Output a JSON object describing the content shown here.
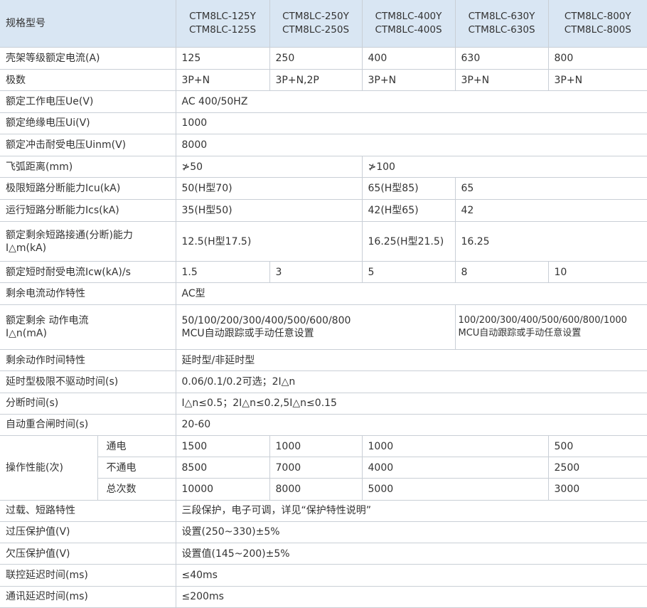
{
  "header": {
    "label": "规格型号",
    "models": [
      {
        "l1": "CTM8LC-125Y",
        "l2": "CTM8LC-125S"
      },
      {
        "l1": "CTM8LC-250Y",
        "l2": "CTM8LC-250S"
      },
      {
        "l1": "CTM8LC-400Y",
        "l2": "CTM8LC-400S"
      },
      {
        "l1": "CTM8LC-630Y",
        "l2": "CTM8LC-630S"
      },
      {
        "l1": "CTM8LC-800Y",
        "l2": "CTM8LC-800S"
      }
    ]
  },
  "rows": {
    "frame_current": {
      "label": "壳架等级额定电流(A)",
      "v": [
        "125",
        "250",
        "400",
        "630",
        "800"
      ]
    },
    "poles": {
      "label": "极数",
      "v": [
        "3P+N",
        "3P+N,2P",
        "3P+N",
        "3P+N",
        "3P+N"
      ]
    },
    "ue": {
      "label": "额定工作电压Ue(V)",
      "v": "AC 400/50HZ"
    },
    "ui": {
      "label": "额定绝缘电压Ui(V)",
      "v": "1000"
    },
    "uimp": {
      "label": "额定冲击耐受电压Uinm(V)",
      "v": "8000"
    },
    "arc": {
      "label": "飞弧距离(mm)",
      "v": [
        "≯50",
        "≯100"
      ]
    },
    "icu": {
      "label": "极限短路分断能力Icu(kA)",
      "v": [
        "50(H型70)",
        "65(H型85)",
        "65"
      ]
    },
    "ics": {
      "label": "运行短路分断能力Ics(kA)",
      "v": [
        "35(H型50)",
        "42(H型65)",
        "42"
      ]
    },
    "idm": {
      "label_l1": "额定剩余短路接通(分断)能力",
      "label_l2": "I△m(kA)",
      "v": [
        "12.5(H型17.5)",
        "16.25(H型21.5)",
        "16.25"
      ]
    },
    "icw": {
      "label": "额定短时耐受电流Icw(kA)/s",
      "v": [
        "1.5",
        "3",
        "5",
        "8",
        "10"
      ]
    },
    "residual_char": {
      "label": "剩余电流动作特性",
      "v": "AC型"
    },
    "idn": {
      "label_l1": "额定剩余 动作电流",
      "label_l2": "I△n(mA)",
      "v1_l1": "50/100/200/300/400/500/600/800",
      "v1_l2": "MCU自动跟踪或手动任意设置",
      "v2_l1": "100/200/300/400/500/600/800/1000",
      "v2_l2": "MCU自动跟踪或手动任意设置"
    },
    "residual_time": {
      "label": "剩余动作时间特性",
      "v": "延时型/非延时型"
    },
    "delay_limit": {
      "label": "延时型极限不驱动时间(s)",
      "v": "0.06/0.1/0.2可选；2I△n"
    },
    "break_time": {
      "label": "分断时间(s)",
      "v": "I△n≤0.5；2I△n≤0.2,5I△n≤0.15"
    },
    "reclose": {
      "label": "自动重合闸时间(s)",
      "v": "20-60"
    },
    "operation": {
      "label": "操作性能(次)",
      "sub": [
        {
          "label": "通电",
          "v": [
            "1500",
            "1000",
            "1000",
            "500"
          ]
        },
        {
          "label": "不通电",
          "v": [
            "8500",
            "7000",
            "4000",
            "2500"
          ]
        },
        {
          "label": "总次数",
          "v": [
            "10000",
            "8000",
            "5000",
            "3000"
          ]
        }
      ]
    },
    "overload": {
      "label": "过载、短路特性",
      "v": "三段保护，电子可调，详见“保护特性说明”"
    },
    "overvoltage": {
      "label": "过压保护值(V)",
      "v": "设置(250~330)±5%"
    },
    "undervoltage": {
      "label": "欠压保护值(V)",
      "v": "设置值(145~200)±5%"
    },
    "interlock": {
      "label": "联控延迟时间(ms)",
      "v": "≤40ms"
    },
    "comm_delay": {
      "label": "通讯延迟时间(ms)",
      "v": "≤200ms"
    }
  }
}
